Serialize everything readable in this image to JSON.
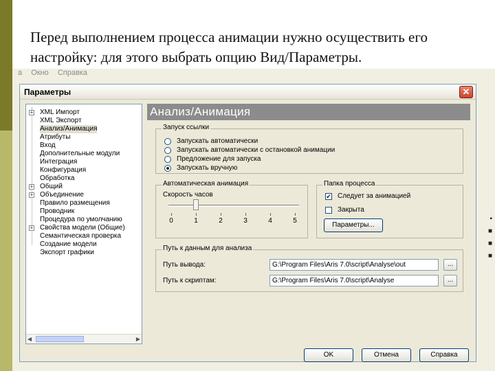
{
  "slide": {
    "caption": "Перед выполнением процесса анимации нужно осуществить его настройку: для этого выбрать опцию Вид/Параметры."
  },
  "menu_faded": [
    "а",
    "Окно",
    "Справка"
  ],
  "dialog": {
    "title": "Параметры",
    "tree": [
      {
        "label": "XML Импорт",
        "expander": "+"
      },
      {
        "label": "XML Экспорт",
        "expander": ""
      },
      {
        "label": "Анализ/Анимация",
        "expander": "",
        "selected": true
      },
      {
        "label": "Атрибуты",
        "expander": ""
      },
      {
        "label": "Вход",
        "expander": ""
      },
      {
        "label": "Дополнительные модули",
        "expander": ""
      },
      {
        "label": "Интеграция",
        "expander": ""
      },
      {
        "label": "Конфигурация",
        "expander": ""
      },
      {
        "label": "Обработка",
        "expander": ""
      },
      {
        "label": "Общий",
        "expander": "+"
      },
      {
        "label": "Объединение",
        "expander": "+"
      },
      {
        "label": "Правило размещения",
        "expander": ""
      },
      {
        "label": "Проводник",
        "expander": ""
      },
      {
        "label": "Процедура по умолчанию",
        "expander": ""
      },
      {
        "label": "Свойства модели (Общие)",
        "expander": "+"
      },
      {
        "label": "Семантическая проверка",
        "expander": ""
      },
      {
        "label": "Создание модели",
        "expander": ""
      },
      {
        "label": "Экспорт графики",
        "expander": ""
      }
    ],
    "pane_header": "Анализ/Анимация",
    "launch_group": {
      "legend": "Запуск ссылки",
      "options": [
        {
          "label": "Запускать автоматически",
          "checked": false
        },
        {
          "label": "Запускать автоматически с остановкой анимации",
          "checked": false
        },
        {
          "label": "Предложение для запуска",
          "checked": false
        },
        {
          "label": "Запускать вручную",
          "checked": true
        }
      ]
    },
    "auto_anim_group": {
      "legend": "Автоматическая анимация",
      "speed_label": "Скорость часов",
      "speed_value": 1,
      "ticks": [
        "0",
        "1",
        "2",
        "3",
        "4",
        "5"
      ]
    },
    "process_folder_group": {
      "legend": "Папка процесса",
      "follow_label": "Следует за анимацией",
      "follow_checked": true,
      "close_label": "Закрыта",
      "close_checked": false,
      "params_button": "Параметры..."
    },
    "paths_group": {
      "legend": "Путь к данным для анализа",
      "output_label": "Путь вывода:",
      "output_value": "G:\\Program Files\\Aris 7.0\\script\\Analyse\\out",
      "scripts_label": "Путь к скриптам:",
      "scripts_value": "G:\\Program Files\\Aris 7.0\\script\\Analyse",
      "browse_label": "..."
    },
    "buttons": {
      "ok": "OK",
      "cancel": "Отмена",
      "help": "Справка"
    },
    "close_glyph": "✕"
  },
  "edge_marks": [
    "▪",
    "■",
    "■",
    "■"
  ]
}
